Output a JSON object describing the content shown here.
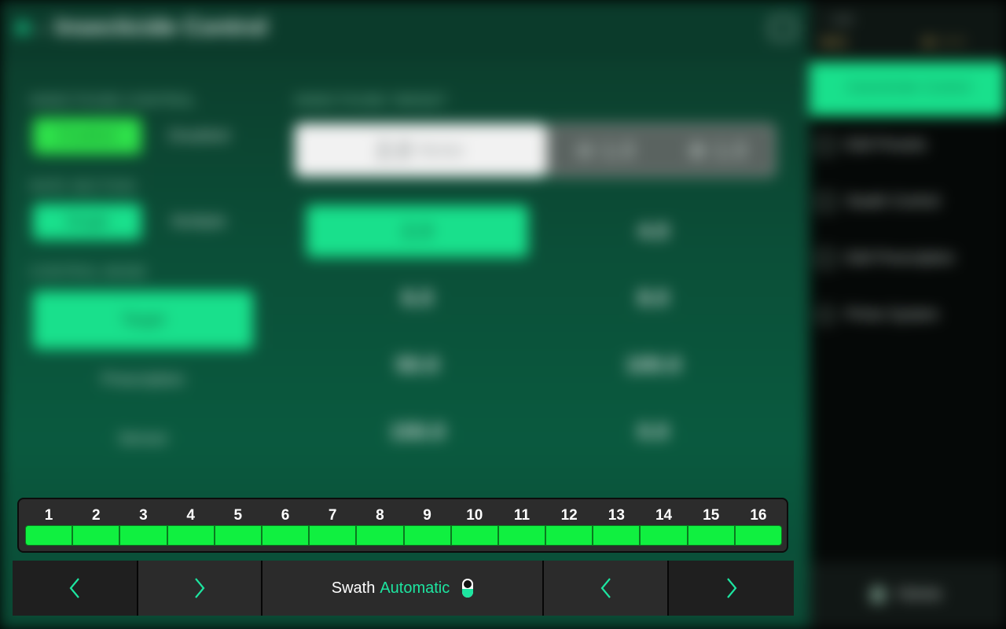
{
  "header": {
    "title": "Insecticide Control"
  },
  "left_panel": {
    "control_label": "INSECTICIDE CONTROL",
    "control_options": [
      "Enabled",
      "Disabled"
    ],
    "rate_label": "RATE SECTION",
    "rate_options": [
      "Single",
      "Multiple"
    ],
    "mode_label": "CONTROL MODE",
    "mode_options": [
      "Target",
      "Prescription",
      "Sensor"
    ]
  },
  "target": {
    "label": "INSECTICIDE TARGET",
    "value": "2.0",
    "unit": "lbs/ac",
    "decrement": "1.0",
    "increment": "1.0",
    "presets": [
      "2.0",
      "4.0",
      "6.0",
      "8.0",
      "50.0",
      "100.0",
      "150.0",
      "0.0"
    ]
  },
  "status": {
    "speed": "-- mph"
  },
  "side_menu": {
    "items": [
      "Insecticide Control",
      "Edit Presets",
      "Swath Control",
      "Edit Prescription",
      "Prime System"
    ],
    "home_label": "Home"
  },
  "swath": {
    "sections": [
      "1",
      "2",
      "3",
      "4",
      "5",
      "6",
      "7",
      "8",
      "9",
      "10",
      "11",
      "12",
      "13",
      "14",
      "15",
      "16"
    ],
    "section_color": "#10f040",
    "label": "Swath",
    "mode": "Automatic",
    "accent": "#1de5a0"
  }
}
